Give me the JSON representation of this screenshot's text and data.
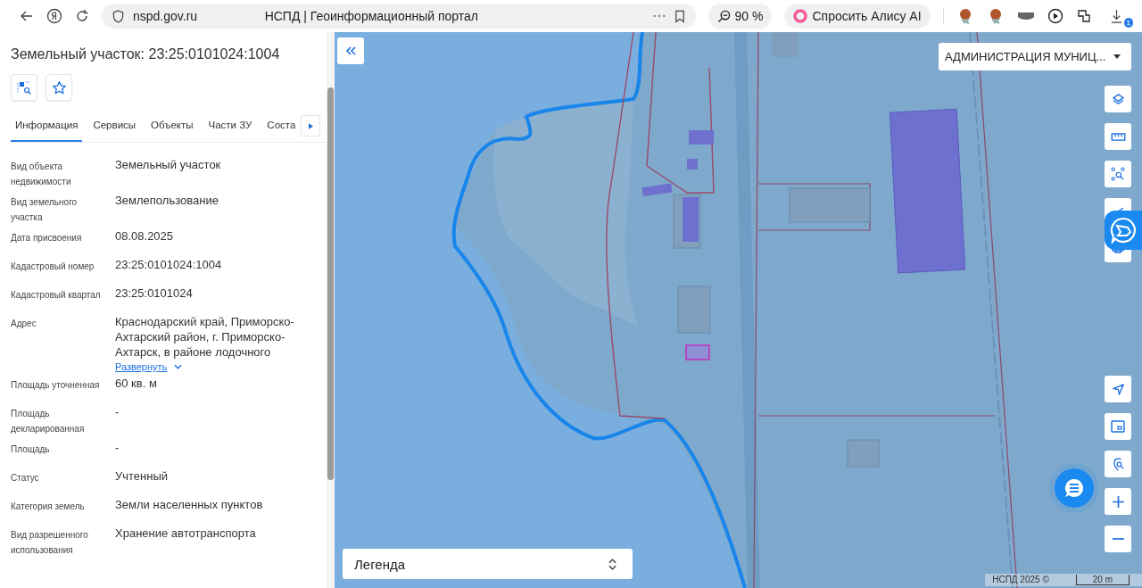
{
  "browser": {
    "url": "nspd.gov.ru",
    "title": "НСПД | Геоинформационный портал",
    "zoom": "90 %",
    "assistant": "Спросить Алису AI",
    "downloads_badge": "1"
  },
  "panel": {
    "title": "Земельный участок: 23:25:0101024:1004",
    "tabs": [
      {
        "label": "Информация",
        "selected": true
      },
      {
        "label": "Сервисы",
        "selected": false
      },
      {
        "label": "Объекты",
        "selected": false
      },
      {
        "label": "Части ЗУ",
        "selected": false
      },
      {
        "label": "Соста",
        "selected": false
      }
    ],
    "fields": [
      {
        "label": "Вид объекта недвижимости",
        "value": "Земельный участок"
      },
      {
        "label": "Вид земельного участка",
        "value": "Землепользование"
      },
      {
        "label": "Дата присвоения",
        "value": "08.08.2025"
      },
      {
        "label": "Кадастровый номер",
        "value": "23:25:0101024:1004"
      },
      {
        "label": "Кадастровый квартал",
        "value": "23:25:0101024"
      },
      {
        "label": "Адрес",
        "value": "Краснодарский край, Приморско-Ахтарский район, г. Приморско-Ахтарск, в районе лодочного",
        "link": "Развернуть"
      },
      {
        "label": "Площадь уточненная",
        "value": "60 кв. м"
      },
      {
        "label": "Площадь декларированная",
        "value": "-"
      },
      {
        "label": "Площадь",
        "value": "-"
      },
      {
        "label": "Статус",
        "value": "Учтенный"
      },
      {
        "label": "Категория земель",
        "value": "Земли населенных пунктов"
      },
      {
        "label": "Вид разрешенного использования",
        "value": "Хранение автотранспорта"
      }
    ]
  },
  "map": {
    "layer_select": "АДМИНИСТРАЦИЯ МУНИЦ...",
    "legend": "Легенда",
    "attribution": "НСПД 2025 ©",
    "scale": "20 m"
  }
}
